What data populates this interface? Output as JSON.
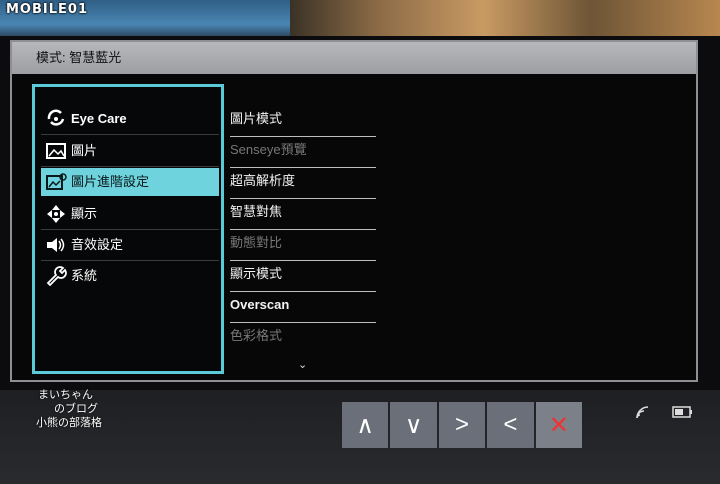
{
  "watermark": "MOBILE01",
  "osd": {
    "title": "模式: 智慧藍光",
    "menu": [
      {
        "label": "Eye Care",
        "icon": "eye-care-icon",
        "active": false
      },
      {
        "label": "圖片",
        "icon": "picture-icon",
        "active": false
      },
      {
        "label": "圖片進階設定",
        "icon": "picture-advanced-icon",
        "active": true
      },
      {
        "label": "顯示",
        "icon": "display-icon",
        "active": false
      },
      {
        "label": "音效設定",
        "icon": "speaker-icon",
        "active": false
      },
      {
        "label": "系統",
        "icon": "wrench-icon",
        "active": false
      }
    ],
    "submenu": [
      {
        "label": "圖片模式",
        "enabled": true
      },
      {
        "label": "Senseye預覽",
        "enabled": false
      },
      {
        "label": "超高解析度",
        "enabled": true
      },
      {
        "label": "智慧對焦",
        "enabled": true
      },
      {
        "label": "動態對比",
        "enabled": false
      },
      {
        "label": "顯示模式",
        "enabled": true
      },
      {
        "label": "Overscan",
        "enabled": true
      },
      {
        "label": "色彩格式",
        "enabled": false
      }
    ],
    "more_indicator": "⌄"
  },
  "buttons": [
    {
      "label": "∧",
      "name": "up-button"
    },
    {
      "label": "∨",
      "name": "down-button"
    },
    {
      "label": ">",
      "name": "right-button"
    },
    {
      "label": "<",
      "name": "left-button"
    },
    {
      "label": "✕",
      "name": "close-button"
    }
  ],
  "signature": {
    "line1": "まいちゃん",
    "line2": "のブログ",
    "line3": "小熊の部落格"
  },
  "colors": {
    "accent": "#6fd3de",
    "close": "#e33333"
  }
}
